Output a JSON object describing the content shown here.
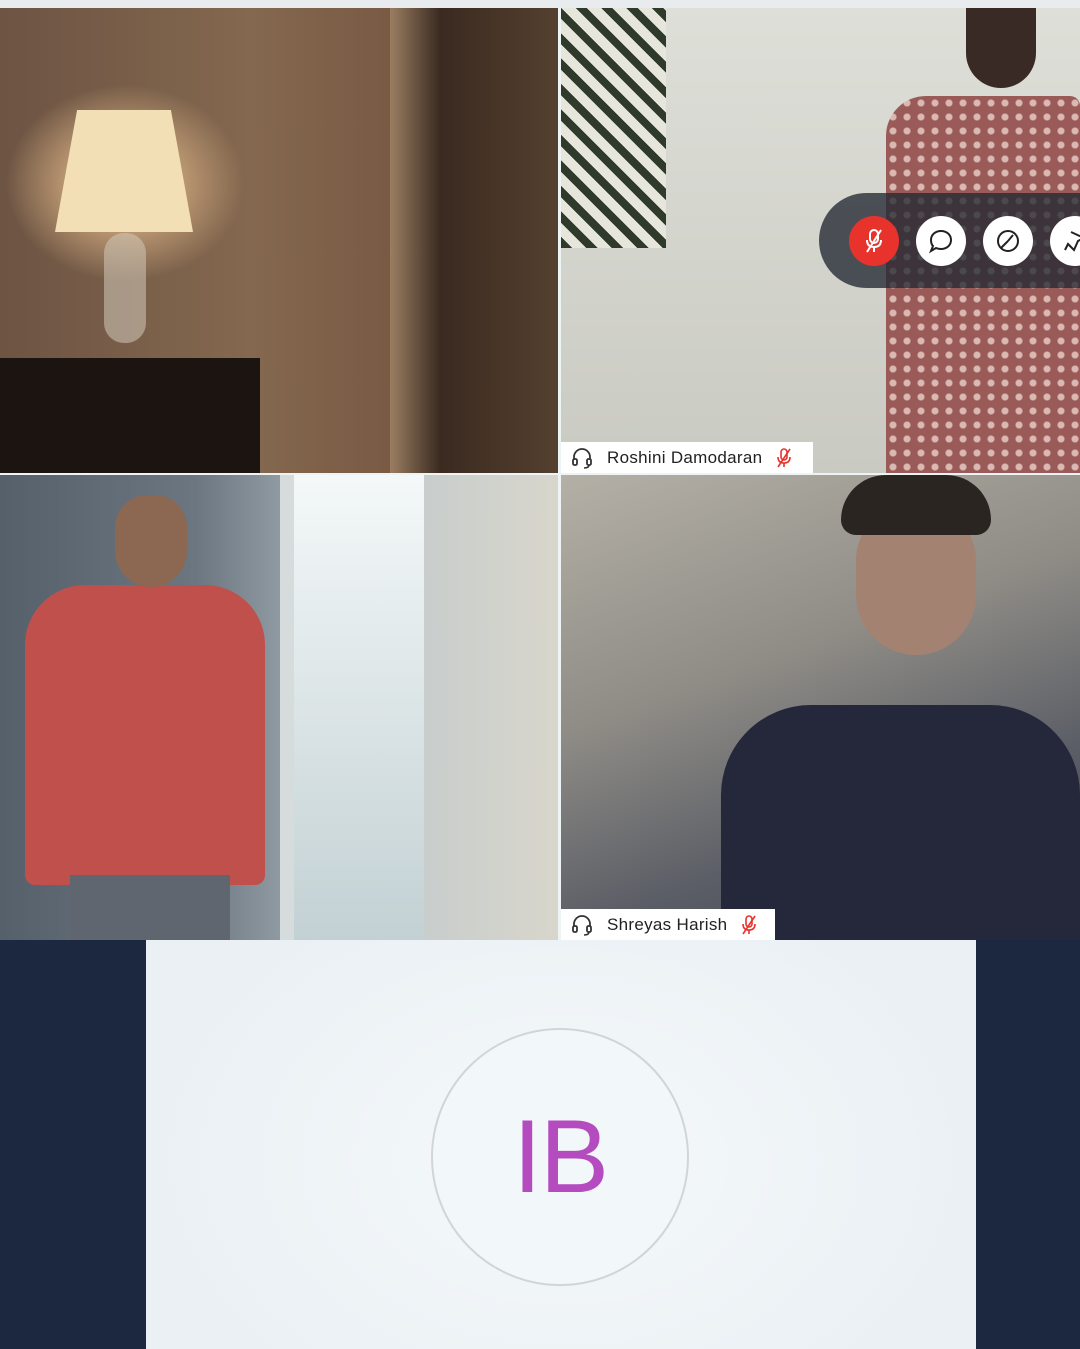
{
  "participants": [
    {
      "name": "Roshini Damodaran",
      "audio": "headset-icon",
      "status": "muted"
    },
    {
      "name": "Shreyas Harish",
      "audio": "headset-icon",
      "status": "muted"
    }
  ],
  "self_avatar": {
    "initials": "IB",
    "color": "#b44cc0"
  },
  "controls": {
    "icons": [
      "mic-muted-icon",
      "chat-icon",
      "timer-icon",
      "pin-icon"
    ],
    "mic_active_color": "#e8332d"
  },
  "colors": {
    "sidebar": "#1c2740",
    "mute_indicator": "#e8332d"
  }
}
